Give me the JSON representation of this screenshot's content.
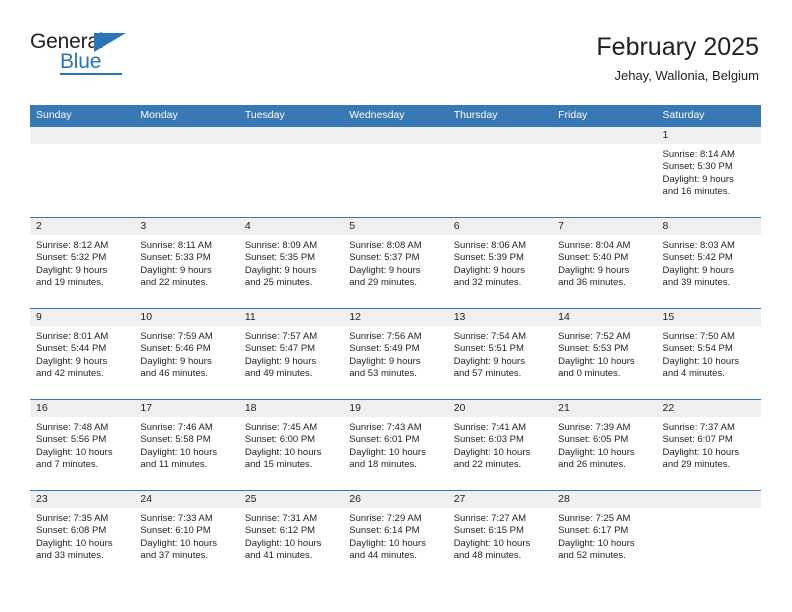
{
  "brand": {
    "name_part1": "General",
    "name_part2": "Blue",
    "accent_color": "#2a74b8",
    "triangle_icon": "brand-triangle-icon"
  },
  "header": {
    "title": "February 2025",
    "subtitle": "Jehay, Wallonia, Belgium"
  },
  "calendar": {
    "header_bg": "#3878b5",
    "daynum_bg": "#efefef",
    "weekday_headers": [
      "Sunday",
      "Monday",
      "Tuesday",
      "Wednesday",
      "Thursday",
      "Friday",
      "Saturday"
    ],
    "labels": {
      "sunrise": "Sunrise:",
      "sunset": "Sunset:",
      "daylight": "Daylight:"
    },
    "weeks": [
      [
        {
          "day": "",
          "sunrise": "",
          "sunset": "",
          "daylight_line1": "",
          "daylight_line2": "",
          "empty": true
        },
        {
          "day": "",
          "sunrise": "",
          "sunset": "",
          "daylight_line1": "",
          "daylight_line2": "",
          "empty": true
        },
        {
          "day": "",
          "sunrise": "",
          "sunset": "",
          "daylight_line1": "",
          "daylight_line2": "",
          "empty": true
        },
        {
          "day": "",
          "sunrise": "",
          "sunset": "",
          "daylight_line1": "",
          "daylight_line2": "",
          "empty": true
        },
        {
          "day": "",
          "sunrise": "",
          "sunset": "",
          "daylight_line1": "",
          "daylight_line2": "",
          "empty": true
        },
        {
          "day": "",
          "sunrise": "",
          "sunset": "",
          "daylight_line1": "",
          "daylight_line2": "",
          "empty": true
        },
        {
          "day": "1",
          "sunrise": "Sunrise: 8:14 AM",
          "sunset": "Sunset: 5:30 PM",
          "daylight_line1": "Daylight: 9 hours",
          "daylight_line2": "and 16 minutes.",
          "empty": false
        }
      ],
      [
        {
          "day": "2",
          "sunrise": "Sunrise: 8:12 AM",
          "sunset": "Sunset: 5:32 PM",
          "daylight_line1": "Daylight: 9 hours",
          "daylight_line2": "and 19 minutes.",
          "empty": false
        },
        {
          "day": "3",
          "sunrise": "Sunrise: 8:11 AM",
          "sunset": "Sunset: 5:33 PM",
          "daylight_line1": "Daylight: 9 hours",
          "daylight_line2": "and 22 minutes.",
          "empty": false
        },
        {
          "day": "4",
          "sunrise": "Sunrise: 8:09 AM",
          "sunset": "Sunset: 5:35 PM",
          "daylight_line1": "Daylight: 9 hours",
          "daylight_line2": "and 25 minutes.",
          "empty": false
        },
        {
          "day": "5",
          "sunrise": "Sunrise: 8:08 AM",
          "sunset": "Sunset: 5:37 PM",
          "daylight_line1": "Daylight: 9 hours",
          "daylight_line2": "and 29 minutes.",
          "empty": false
        },
        {
          "day": "6",
          "sunrise": "Sunrise: 8:06 AM",
          "sunset": "Sunset: 5:39 PM",
          "daylight_line1": "Daylight: 9 hours",
          "daylight_line2": "and 32 minutes.",
          "empty": false
        },
        {
          "day": "7",
          "sunrise": "Sunrise: 8:04 AM",
          "sunset": "Sunset: 5:40 PM",
          "daylight_line1": "Daylight: 9 hours",
          "daylight_line2": "and 36 minutes.",
          "empty": false
        },
        {
          "day": "8",
          "sunrise": "Sunrise: 8:03 AM",
          "sunset": "Sunset: 5:42 PM",
          "daylight_line1": "Daylight: 9 hours",
          "daylight_line2": "and 39 minutes.",
          "empty": false
        }
      ],
      [
        {
          "day": "9",
          "sunrise": "Sunrise: 8:01 AM",
          "sunset": "Sunset: 5:44 PM",
          "daylight_line1": "Daylight: 9 hours",
          "daylight_line2": "and 42 minutes.",
          "empty": false
        },
        {
          "day": "10",
          "sunrise": "Sunrise: 7:59 AM",
          "sunset": "Sunset: 5:46 PM",
          "daylight_line1": "Daylight: 9 hours",
          "daylight_line2": "and 46 minutes.",
          "empty": false
        },
        {
          "day": "11",
          "sunrise": "Sunrise: 7:57 AM",
          "sunset": "Sunset: 5:47 PM",
          "daylight_line1": "Daylight: 9 hours",
          "daylight_line2": "and 49 minutes.",
          "empty": false
        },
        {
          "day": "12",
          "sunrise": "Sunrise: 7:56 AM",
          "sunset": "Sunset: 5:49 PM",
          "daylight_line1": "Daylight: 9 hours",
          "daylight_line2": "and 53 minutes.",
          "empty": false
        },
        {
          "day": "13",
          "sunrise": "Sunrise: 7:54 AM",
          "sunset": "Sunset: 5:51 PM",
          "daylight_line1": "Daylight: 9 hours",
          "daylight_line2": "and 57 minutes.",
          "empty": false
        },
        {
          "day": "14",
          "sunrise": "Sunrise: 7:52 AM",
          "sunset": "Sunset: 5:53 PM",
          "daylight_line1": "Daylight: 10 hours",
          "daylight_line2": "and 0 minutes.",
          "empty": false
        },
        {
          "day": "15",
          "sunrise": "Sunrise: 7:50 AM",
          "sunset": "Sunset: 5:54 PM",
          "daylight_line1": "Daylight: 10 hours",
          "daylight_line2": "and 4 minutes.",
          "empty": false
        }
      ],
      [
        {
          "day": "16",
          "sunrise": "Sunrise: 7:48 AM",
          "sunset": "Sunset: 5:56 PM",
          "daylight_line1": "Daylight: 10 hours",
          "daylight_line2": "and 7 minutes.",
          "empty": false
        },
        {
          "day": "17",
          "sunrise": "Sunrise: 7:46 AM",
          "sunset": "Sunset: 5:58 PM",
          "daylight_line1": "Daylight: 10 hours",
          "daylight_line2": "and 11 minutes.",
          "empty": false
        },
        {
          "day": "18",
          "sunrise": "Sunrise: 7:45 AM",
          "sunset": "Sunset: 6:00 PM",
          "daylight_line1": "Daylight: 10 hours",
          "daylight_line2": "and 15 minutes.",
          "empty": false
        },
        {
          "day": "19",
          "sunrise": "Sunrise: 7:43 AM",
          "sunset": "Sunset: 6:01 PM",
          "daylight_line1": "Daylight: 10 hours",
          "daylight_line2": "and 18 minutes.",
          "empty": false
        },
        {
          "day": "20",
          "sunrise": "Sunrise: 7:41 AM",
          "sunset": "Sunset: 6:03 PM",
          "daylight_line1": "Daylight: 10 hours",
          "daylight_line2": "and 22 minutes.",
          "empty": false
        },
        {
          "day": "21",
          "sunrise": "Sunrise: 7:39 AM",
          "sunset": "Sunset: 6:05 PM",
          "daylight_line1": "Daylight: 10 hours",
          "daylight_line2": "and 26 minutes.",
          "empty": false
        },
        {
          "day": "22",
          "sunrise": "Sunrise: 7:37 AM",
          "sunset": "Sunset: 6:07 PM",
          "daylight_line1": "Daylight: 10 hours",
          "daylight_line2": "and 29 minutes.",
          "empty": false
        }
      ],
      [
        {
          "day": "23",
          "sunrise": "Sunrise: 7:35 AM",
          "sunset": "Sunset: 6:08 PM",
          "daylight_line1": "Daylight: 10 hours",
          "daylight_line2": "and 33 minutes.",
          "empty": false
        },
        {
          "day": "24",
          "sunrise": "Sunrise: 7:33 AM",
          "sunset": "Sunset: 6:10 PM",
          "daylight_line1": "Daylight: 10 hours",
          "daylight_line2": "and 37 minutes.",
          "empty": false
        },
        {
          "day": "25",
          "sunrise": "Sunrise: 7:31 AM",
          "sunset": "Sunset: 6:12 PM",
          "daylight_line1": "Daylight: 10 hours",
          "daylight_line2": "and 41 minutes.",
          "empty": false
        },
        {
          "day": "26",
          "sunrise": "Sunrise: 7:29 AM",
          "sunset": "Sunset: 6:14 PM",
          "daylight_line1": "Daylight: 10 hours",
          "daylight_line2": "and 44 minutes.",
          "empty": false
        },
        {
          "day": "27",
          "sunrise": "Sunrise: 7:27 AM",
          "sunset": "Sunset: 6:15 PM",
          "daylight_line1": "Daylight: 10 hours",
          "daylight_line2": "and 48 minutes.",
          "empty": false
        },
        {
          "day": "28",
          "sunrise": "Sunrise: 7:25 AM",
          "sunset": "Sunset: 6:17 PM",
          "daylight_line1": "Daylight: 10 hours",
          "daylight_line2": "and 52 minutes.",
          "empty": false
        },
        {
          "day": "",
          "sunrise": "",
          "sunset": "",
          "daylight_line1": "",
          "daylight_line2": "",
          "empty": true
        }
      ]
    ]
  }
}
